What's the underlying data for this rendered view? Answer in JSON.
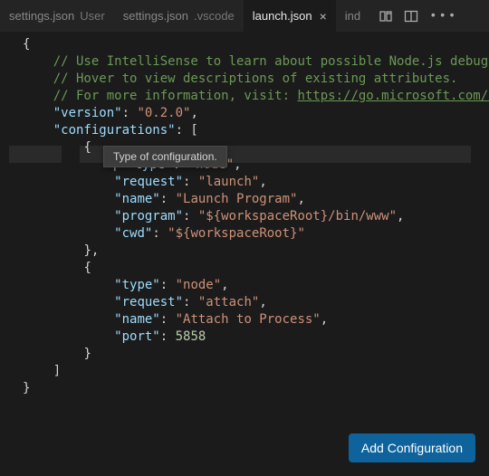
{
  "tabs": [
    {
      "label": "settings.json",
      "desc": "User"
    },
    {
      "label": "settings.json",
      "desc": ".vscode"
    },
    {
      "label": "launch.json",
      "desc": "",
      "active": true
    },
    {
      "label": "ind",
      "desc": ""
    }
  ],
  "tooltip": "Type of configuration.",
  "addButton": "Add Configuration",
  "code": {
    "c1": "// Use IntelliSense to learn about possible Node.js debug attributes",
    "c2": "// Hover to view descriptions of existing attributes.",
    "c3a": "// For more information, visit: ",
    "c3b": "https://go.microsoft.com/fwlink/?li",
    "versionKey": "\"version\"",
    "versionVal": "\"0.2.0\"",
    "configKey": "\"configurations\"",
    "typeKey": "\"type\"",
    "nodeVal": "\"node\"",
    "requestKey": "\"request\"",
    "launchVal": "\"launch\"",
    "attachVal": "\"attach\"",
    "nameKey": "\"name\"",
    "launchProgVal": "\"Launch Program\"",
    "attachProcVal": "\"Attach to Process\"",
    "programKey": "\"program\"",
    "programVal": "\"${workspaceRoot}/bin/www\"",
    "cwdKey": "\"cwd\"",
    "cwdVal": "\"${workspaceRoot}\"",
    "portKey": "\"port\"",
    "portVal": "5858"
  }
}
